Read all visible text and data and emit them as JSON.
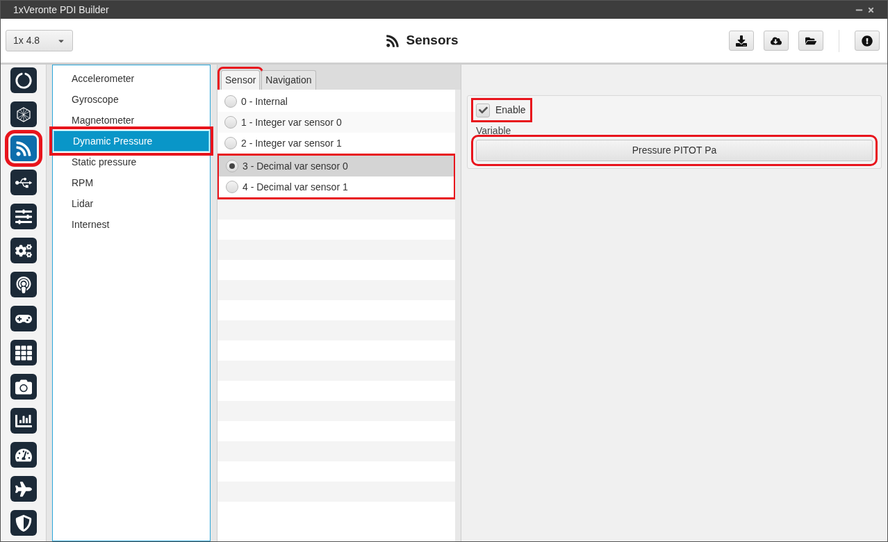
{
  "window": {
    "title": "1xVeronte PDI Builder"
  },
  "header": {
    "version": "1x 4.8",
    "title": "Sensors"
  },
  "toolbar": [
    {
      "kind": "download"
    },
    {
      "kind": "cloud"
    },
    {
      "kind": "folder"
    },
    {
      "kind": "alert"
    }
  ],
  "nav_icons": [
    {
      "selected": false,
      "highlighted": false
    },
    {
      "selected": false,
      "highlighted": false
    },
    {
      "selected": true,
      "highlighted": true
    },
    {
      "selected": false,
      "highlighted": false
    },
    {
      "selected": false,
      "highlighted": false
    },
    {
      "selected": false,
      "highlighted": false
    },
    {
      "selected": false,
      "highlighted": false
    },
    {
      "selected": false,
      "highlighted": false
    },
    {
      "selected": false,
      "highlighted": false
    },
    {
      "selected": false,
      "highlighted": false
    },
    {
      "selected": false,
      "highlighted": false
    },
    {
      "selected": false,
      "highlighted": false
    },
    {
      "selected": false,
      "highlighted": false
    },
    {
      "selected": false,
      "highlighted": false
    }
  ],
  "sensor_list": [
    {
      "label": "Accelerometer",
      "selected": false,
      "highlighted": false
    },
    {
      "label": "Gyroscope",
      "selected": false,
      "highlighted": false
    },
    {
      "label": "Magnetometer",
      "selected": false,
      "highlighted": false
    },
    {
      "label": "Dynamic Pressure",
      "selected": true,
      "highlighted": true
    },
    {
      "label": "Static pressure",
      "selected": false,
      "highlighted": false
    },
    {
      "label": "RPM",
      "selected": false,
      "highlighted": false
    },
    {
      "label": "Lidar",
      "selected": false,
      "highlighted": false
    },
    {
      "label": "Internest",
      "selected": false,
      "highlighted": false
    }
  ],
  "tabs": [
    {
      "label": "Sensor",
      "selected": true,
      "highlighted": true
    },
    {
      "label": "Navigation",
      "selected": false,
      "highlighted": false
    }
  ],
  "options": [
    {
      "label": "0 - Internal",
      "selected": false,
      "highlighted": false
    },
    {
      "label": "1 - Integer var sensor 0",
      "selected": false,
      "highlighted": false
    },
    {
      "label": "2 - Integer var sensor 1",
      "selected": false,
      "highlighted": false
    },
    {
      "label": "3 - Decimal var sensor 0",
      "selected": true,
      "highlighted": true
    },
    {
      "label": "4 - Decimal var sensor 1",
      "selected": false,
      "highlighted": true
    }
  ],
  "settings": {
    "enable": {
      "label": "Enable",
      "checked": true,
      "highlighted": true
    },
    "variable_label": "Variable",
    "variable": {
      "value": "Pressure PITOT Pa",
      "highlighted": true
    }
  }
}
